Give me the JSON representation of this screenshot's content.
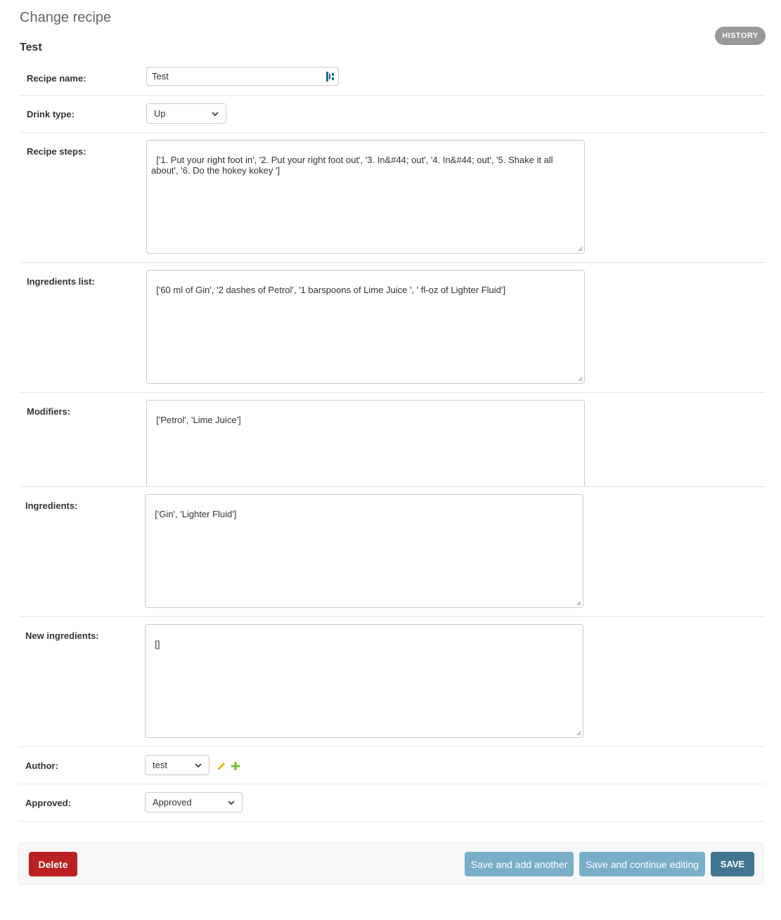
{
  "header": {
    "page_title": "Change recipe",
    "object_title": "Test",
    "history_label": "HISTORY"
  },
  "form": {
    "recipe_name": {
      "label": "Recipe name:",
      "value": "Test"
    },
    "drink_type": {
      "label": "Drink type:",
      "selected": "Up"
    },
    "recipe_steps": {
      "label": "Recipe steps:",
      "value": "['1. Put your right foot in', '2. Put your right foot out', '3. In&#44; out', '4. In&#44; out', '5. Shake it all about', '6. Do the hokey kokey ']"
    },
    "ingredients_list": {
      "label": "Ingredients list:",
      "value": "['60 ml of Gin', '2 dashes of Petrol', '1 barspoons of Lime Juice ', ' fl-oz of Lighter Fluid']"
    },
    "modifiers": {
      "label": "Modifiers:",
      "value": "['Petrol', 'Lime Juice']"
    },
    "ingredients": {
      "label": "Ingredients:",
      "value": "['Gin', 'Lighter Fluid']"
    },
    "new_ingredients": {
      "label": "New ingredients:",
      "value": "[]"
    },
    "author": {
      "label": "Author:",
      "selected": "test",
      "edit_icon": "pencil-icon",
      "add_icon": "plus-icon"
    },
    "approved": {
      "label": "Approved:",
      "selected": "Approved"
    }
  },
  "actions": {
    "delete_label": "Delete",
    "save_add_label": "Save and add another",
    "save_continue_label": "Save and continue editing",
    "save_label": "SAVE"
  },
  "colors": {
    "delete": "#ba2121",
    "secondary_button": "#79aec8",
    "primary_button": "#417690",
    "history_button": "#999999"
  }
}
